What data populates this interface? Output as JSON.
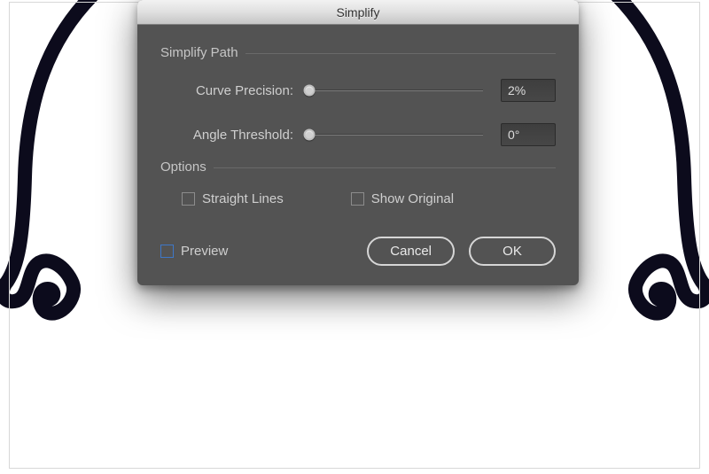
{
  "dialog": {
    "title": "Simplify",
    "simplify_path": {
      "section_title": "Simplify Path",
      "curve_precision": {
        "label": "Curve Precision:",
        "value": "2%",
        "slider_position_pct": 2
      },
      "angle_threshold": {
        "label": "Angle Threshold:",
        "value": "0°",
        "slider_position_pct": 0
      }
    },
    "options": {
      "section_title": "Options",
      "straight_lines": {
        "label": "Straight Lines",
        "checked": false
      },
      "show_original": {
        "label": "Show Original",
        "checked": false
      }
    },
    "preview": {
      "label": "Preview",
      "checked": false
    },
    "buttons": {
      "cancel": "Cancel",
      "ok": "OK"
    }
  }
}
